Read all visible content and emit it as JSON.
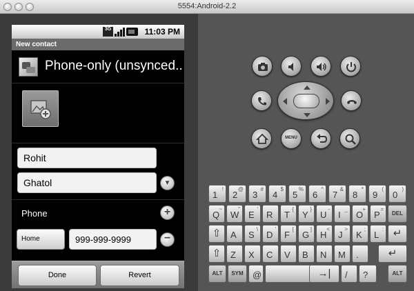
{
  "window": {
    "title": "5554:Android-2.2"
  },
  "status_bar": {
    "network": "3G",
    "time": "11:03 PM"
  },
  "app": {
    "title": "New contact"
  },
  "account": {
    "label": "Phone-only (unsynced..."
  },
  "name": {
    "first": "Rohit",
    "last": "Ghatol"
  },
  "phone": {
    "section_label": "Phone",
    "type": "Home",
    "value": "999-999-9999"
  },
  "buttons": {
    "done": "Done",
    "revert": "Revert"
  },
  "hardware": {
    "menu_label": "MENU"
  },
  "keyboard": {
    "rows": [
      [
        [
          "1",
          "!"
        ],
        [
          "2",
          "@"
        ],
        [
          "3",
          "#"
        ],
        [
          "4",
          "$"
        ],
        [
          "5",
          "%"
        ],
        [
          "6",
          "^"
        ],
        [
          "7",
          "&"
        ],
        [
          "8",
          "*"
        ],
        [
          "9",
          "("
        ],
        [
          "0",
          ")"
        ]
      ],
      [
        [
          "Q",
          "~"
        ],
        [
          "W",
          "\""
        ],
        [
          "E",
          "'"
        ],
        [
          "R",
          ""
        ],
        [
          "T",
          "{"
        ],
        [
          "Y",
          "}"
        ],
        [
          "U",
          "-"
        ],
        [
          "I",
          "_"
        ],
        [
          "O",
          "+"
        ],
        [
          "P",
          "="
        ],
        [
          "DEL",
          ""
        ]
      ],
      [
        [
          "⇧",
          ""
        ],
        [
          "A",
          ""
        ],
        [
          "S",
          "\\"
        ],
        [
          "D",
          "'"
        ],
        [
          "F",
          "["
        ],
        [
          "G",
          "]"
        ],
        [
          "H",
          "<"
        ],
        [
          "J",
          ">"
        ],
        [
          "K",
          ";"
        ],
        [
          "L",
          ":"
        ],
        [
          "↵",
          ""
        ]
      ],
      [
        [
          "⇧",
          ""
        ],
        [
          "Z",
          ""
        ],
        [
          "X",
          ""
        ],
        [
          "C",
          ""
        ],
        [
          "V",
          ""
        ],
        [
          "B",
          ""
        ],
        [
          "N",
          ""
        ],
        [
          "M",
          ""
        ],
        [
          ".",
          ""
        ],
        [
          "↵",
          ""
        ]
      ],
      [
        [
          "ALT",
          ""
        ],
        [
          "SYM",
          ""
        ],
        [
          "@",
          ""
        ],
        [
          "",
          ""
        ],
        [
          "→|",
          ""
        ],
        [
          "/",
          ""
        ],
        [
          "?",
          ""
        ],
        [
          ",",
          ""
        ],
        [
          "ALT",
          ""
        ]
      ]
    ]
  }
}
